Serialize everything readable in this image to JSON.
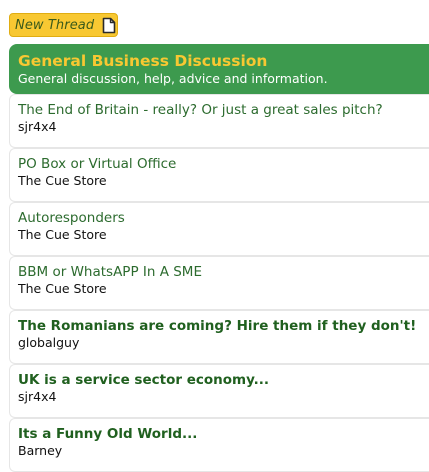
{
  "toolbar": {
    "new_thread_label": "New Thread",
    "new_thread_icon": "document-icon"
  },
  "forum": {
    "title": "General Business Discussion",
    "description": "General discussion, help, advice and information."
  },
  "colors": {
    "header_green": "#3d9a4e",
    "title_gold": "#f8c832",
    "link_green": "#2c6b2e"
  },
  "threads": [
    {
      "title": "The End of Britain - really? Or just a great sales pitch?",
      "author": "sjr4x4",
      "unread": false
    },
    {
      "title": "PO Box or Virtual Office",
      "author": "The Cue Store",
      "unread": false
    },
    {
      "title": "Autoresponders",
      "author": "The Cue Store",
      "unread": false
    },
    {
      "title": "BBM or WhatsAPP In A SME",
      "author": "The Cue Store",
      "unread": false
    },
    {
      "title": "The Romanians are coming? Hire them if they don't!",
      "author": "globalguy",
      "unread": true
    },
    {
      "title": "UK is a service sector economy...",
      "author": "sjr4x4",
      "unread": true
    },
    {
      "title": "Its a Funny Old World...",
      "author": "Barney",
      "unread": true
    }
  ]
}
